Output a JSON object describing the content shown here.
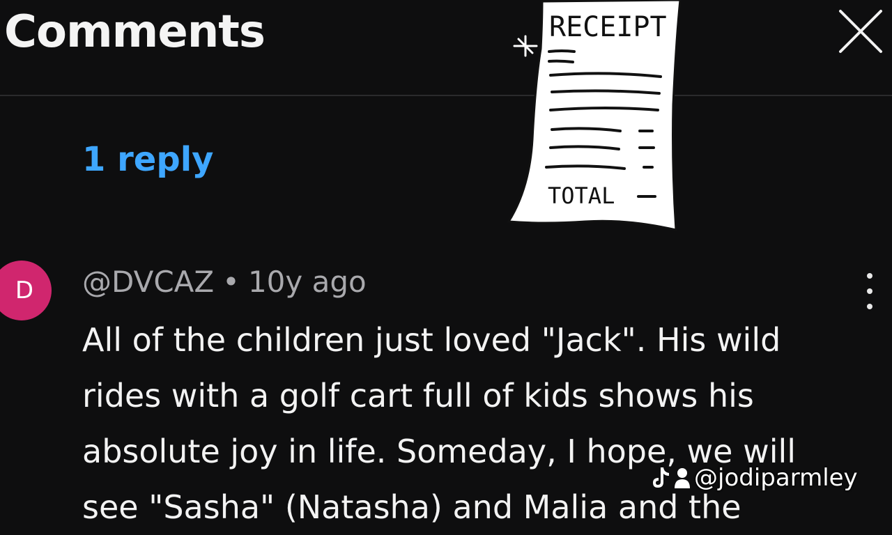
{
  "header": {
    "title": "Comments"
  },
  "thread": {
    "reply_link": "1 reply"
  },
  "sticker": {
    "heading": "RECEIPT",
    "total_label": "TOTAL"
  },
  "comment": {
    "avatar_letter": "D",
    "avatar_color": "#d0266e",
    "username": "@DVCAZ",
    "separator": "•",
    "time_ago": "10y ago",
    "lines": [
      "All of the children just loved \"Jack\". His wild",
      "rides with a golf cart full of kids shows his",
      "absolute joy in life. Someday, I hope, we will",
      "see \"Sasha\" (Natasha) and Malia and the"
    ]
  },
  "watermark": {
    "handle": "@jodiparmley",
    "icons": [
      "tiktok-icon",
      "profile-icon"
    ]
  },
  "colors": {
    "background": "#0e0e0f",
    "link": "#3ea6ff",
    "meta_text": "#a9a9ad"
  }
}
